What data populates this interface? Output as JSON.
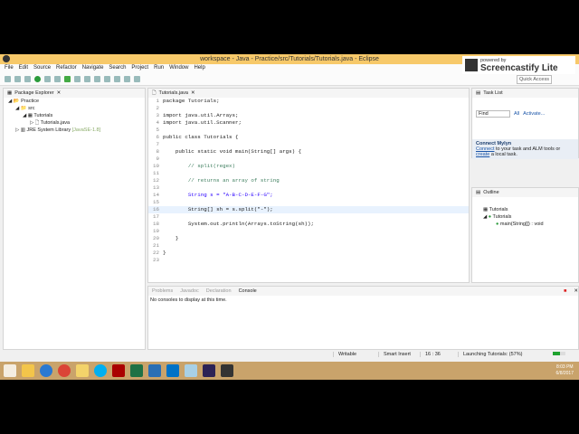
{
  "window": {
    "title": "workspace - Java - Practice/src/Tutorials/Tutorials.java - Eclipse"
  },
  "overlay": {
    "powered": "powered by",
    "brand": "Screencastify Lite"
  },
  "menu": [
    "File",
    "Edit",
    "Source",
    "Refactor",
    "Navigate",
    "Search",
    "Project",
    "Run",
    "Window",
    "Help"
  ],
  "quick_access": "Quick Access",
  "package_explorer": {
    "title": "Package Explorer",
    "tree": [
      "Practice",
      "src",
      "Tutorials",
      "Tutorials.java",
      "JRE System Library"
    ],
    "jre_suffix": "[JavaSE-1.8]"
  },
  "editor": {
    "tab": "Tutorials.java",
    "lines": [
      "package Tutorials;",
      "",
      "import java.util.Arrays;",
      "import java.util.Scanner;",
      "",
      "public class Tutorials {",
      "",
      "    public static void main(String[] args) {",
      "",
      "        // split(regex)",
      "",
      "        // returns an array of string",
      "",
      "        String s = \"A-B-C-D-E-F-G\";",
      "",
      "        String[] sh = s.split(\"-\");",
      "",
      "        System.out.println(Arrays.toString(sh));",
      "",
      "    }",
      "",
      "}",
      ""
    ]
  },
  "task_list": {
    "title": "Task List",
    "find": "Find",
    "all": "All",
    "activate": "Activate..."
  },
  "mylyn": {
    "title": "Connect Mylyn",
    "connect": "Connect",
    "text1": " to your task and ALM tools or",
    "create": "create",
    "text2": " a local task."
  },
  "outline": {
    "title": "Outline",
    "items": [
      "Tutorials",
      "Tutorials",
      "main(String[]) : void"
    ]
  },
  "console": {
    "tabs": [
      "Problems",
      "Javadoc",
      "Declaration",
      "Console"
    ],
    "message": "No consoles to display at this time."
  },
  "status": {
    "writable": "Writable",
    "insert": "Smart Insert",
    "position": "16 : 36",
    "launch": "Launching Tutorials: (57%)",
    "progress": 57
  },
  "clock": {
    "time": "8:03 PM",
    "date": "6/8/2017"
  }
}
